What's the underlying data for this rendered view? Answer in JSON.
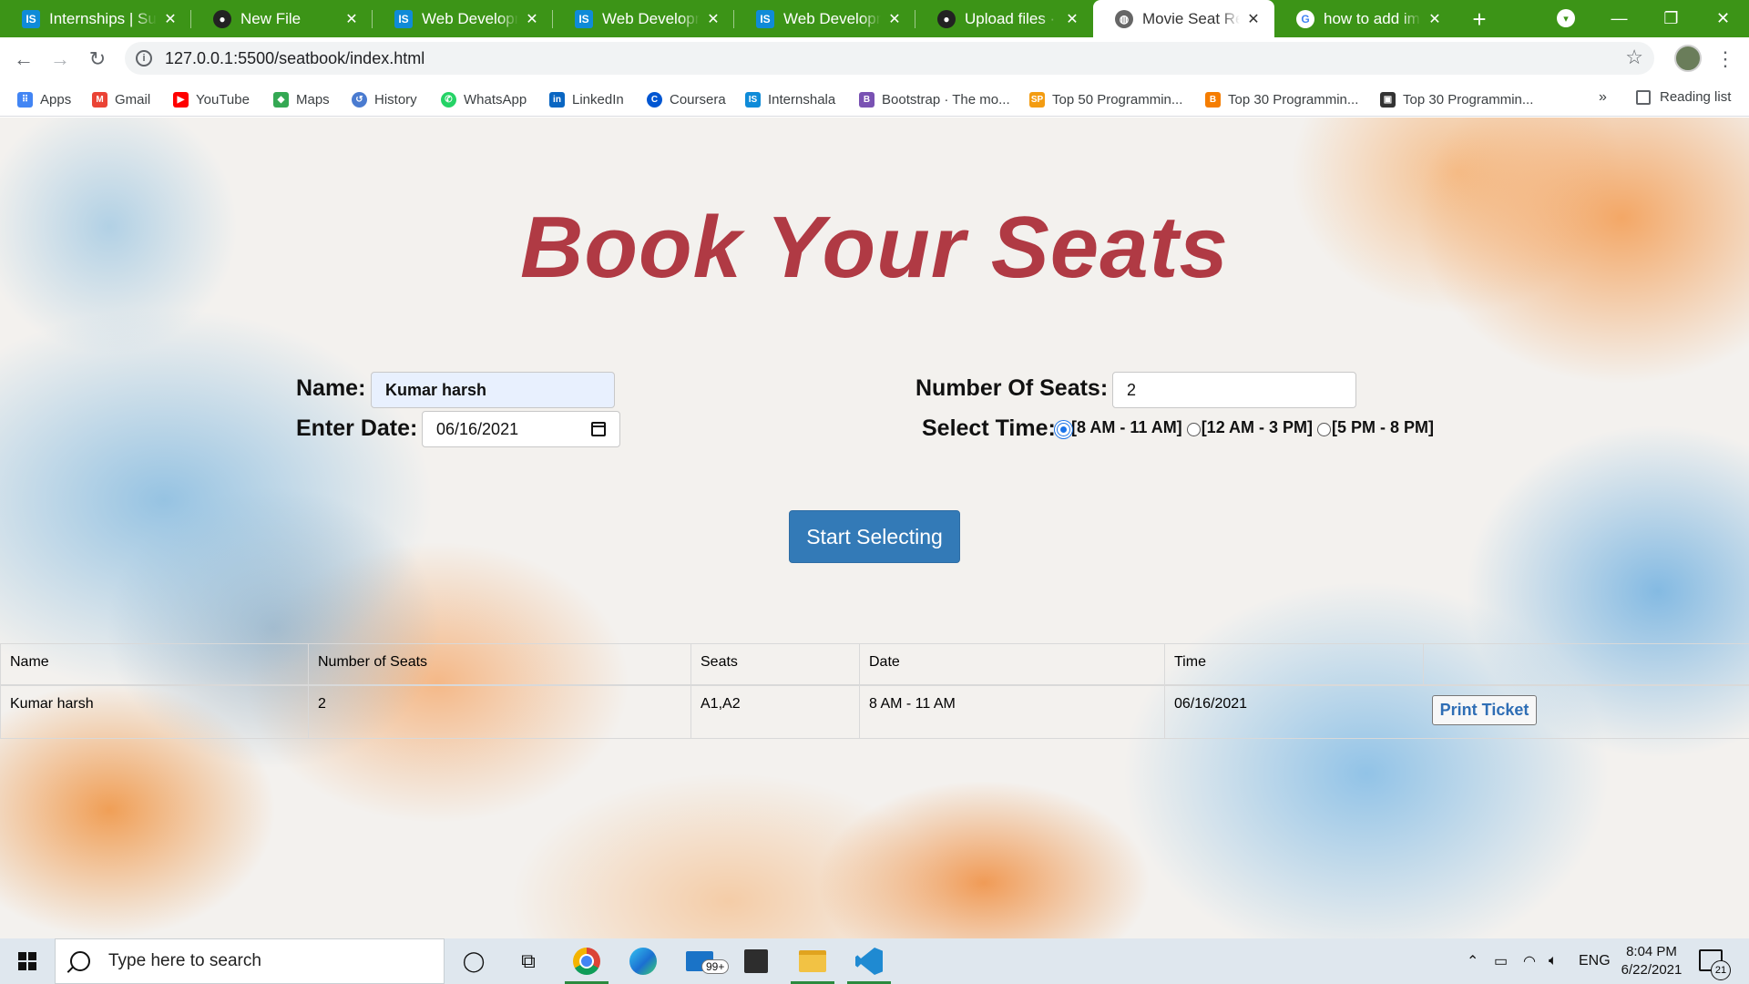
{
  "browser": {
    "tabs": [
      {
        "title": "Internships | Summer",
        "favicon": "internshala-icon"
      },
      {
        "title": "New File",
        "favicon": "github-icon"
      },
      {
        "title": "Web Development",
        "favicon": "internshala-icon"
      },
      {
        "title": "Web Development",
        "favicon": "internshala-icon"
      },
      {
        "title": "Web Development",
        "favicon": "internshala-icon"
      },
      {
        "title": "Upload files · harsh",
        "favicon": "github-icon"
      },
      {
        "title": "Movie Seat Reservation",
        "favicon": "globe-icon"
      },
      {
        "title": "how to add image",
        "favicon": "google-icon"
      }
    ],
    "active_tab_index": 6,
    "url": "127.0.0.1:5500/seatbook/index.html",
    "bookmarks": [
      {
        "label": "Apps",
        "icon": "apps-grid-icon",
        "color": "#4285f4"
      },
      {
        "label": "Gmail",
        "icon": "gmail-icon",
        "color": "#ea4335"
      },
      {
        "label": "YouTube",
        "icon": "youtube-icon",
        "color": "#ff0000"
      },
      {
        "label": "Maps",
        "icon": "maps-icon",
        "color": "#34a853"
      },
      {
        "label": "History",
        "icon": "history-icon",
        "color": "#4a7bd0"
      },
      {
        "label": "WhatsApp",
        "icon": "whatsapp-icon",
        "color": "#25d366"
      },
      {
        "label": "LinkedIn",
        "icon": "linkedin-icon",
        "color": "#0a66c2"
      },
      {
        "label": "Coursera",
        "icon": "coursera-icon",
        "color": "#0056d2"
      },
      {
        "label": "Internshala",
        "icon": "internshala-icon",
        "color": "#0f8bd8"
      },
      {
        "label": "Bootstrap · The mo...",
        "icon": "bootstrap-icon",
        "color": "#7952b3"
      },
      {
        "label": "Top 50 Programmin...",
        "icon": "sp-icon",
        "color": "#f39c12"
      },
      {
        "label": "Top 30 Programmin...",
        "icon": "blogger-icon",
        "color": "#f57d00"
      },
      {
        "label": "Top 30 Programmin...",
        "icon": "book-icon",
        "color": "#333333"
      }
    ],
    "more_bookmarks": "»",
    "reading_list": "Reading list"
  },
  "page": {
    "title": "Book Your Seats",
    "name_label": "Name:",
    "name_value": "Kumar harsh",
    "date_label": "Enter Date:",
    "date_value": "06/16/2021",
    "seats_label": "Number Of Seats:",
    "seats_value": "2",
    "time_label": "Select Time:",
    "time_options": [
      {
        "label": "[8 AM - 11 AM]",
        "checked": true
      },
      {
        "label": "[12 AM - 3 PM]",
        "checked": false
      },
      {
        "label": "[5 PM - 8 PM]",
        "checked": false
      }
    ],
    "start_button": "Start Selecting",
    "table": {
      "headers": [
        "Name",
        "Number of Seats",
        "Seats",
        "Date",
        "Time",
        ""
      ],
      "rows": [
        {
          "name": "Kumar harsh",
          "seats_count": "2",
          "seats": "A1,A2",
          "date": "8 AM - 11 AM",
          "time": "06/16/2021",
          "action": "Print Ticket"
        }
      ]
    },
    "colors": {
      "title": "#b03a44",
      "button": "#337ab7",
      "accent_tab_strip": "#3c9417"
    }
  },
  "taskbar": {
    "search_placeholder": "Type here to search",
    "mail_badge": "99+",
    "language": "ENG",
    "time": "8:04 PM",
    "date": "6/22/2021",
    "notification_count": "21"
  }
}
